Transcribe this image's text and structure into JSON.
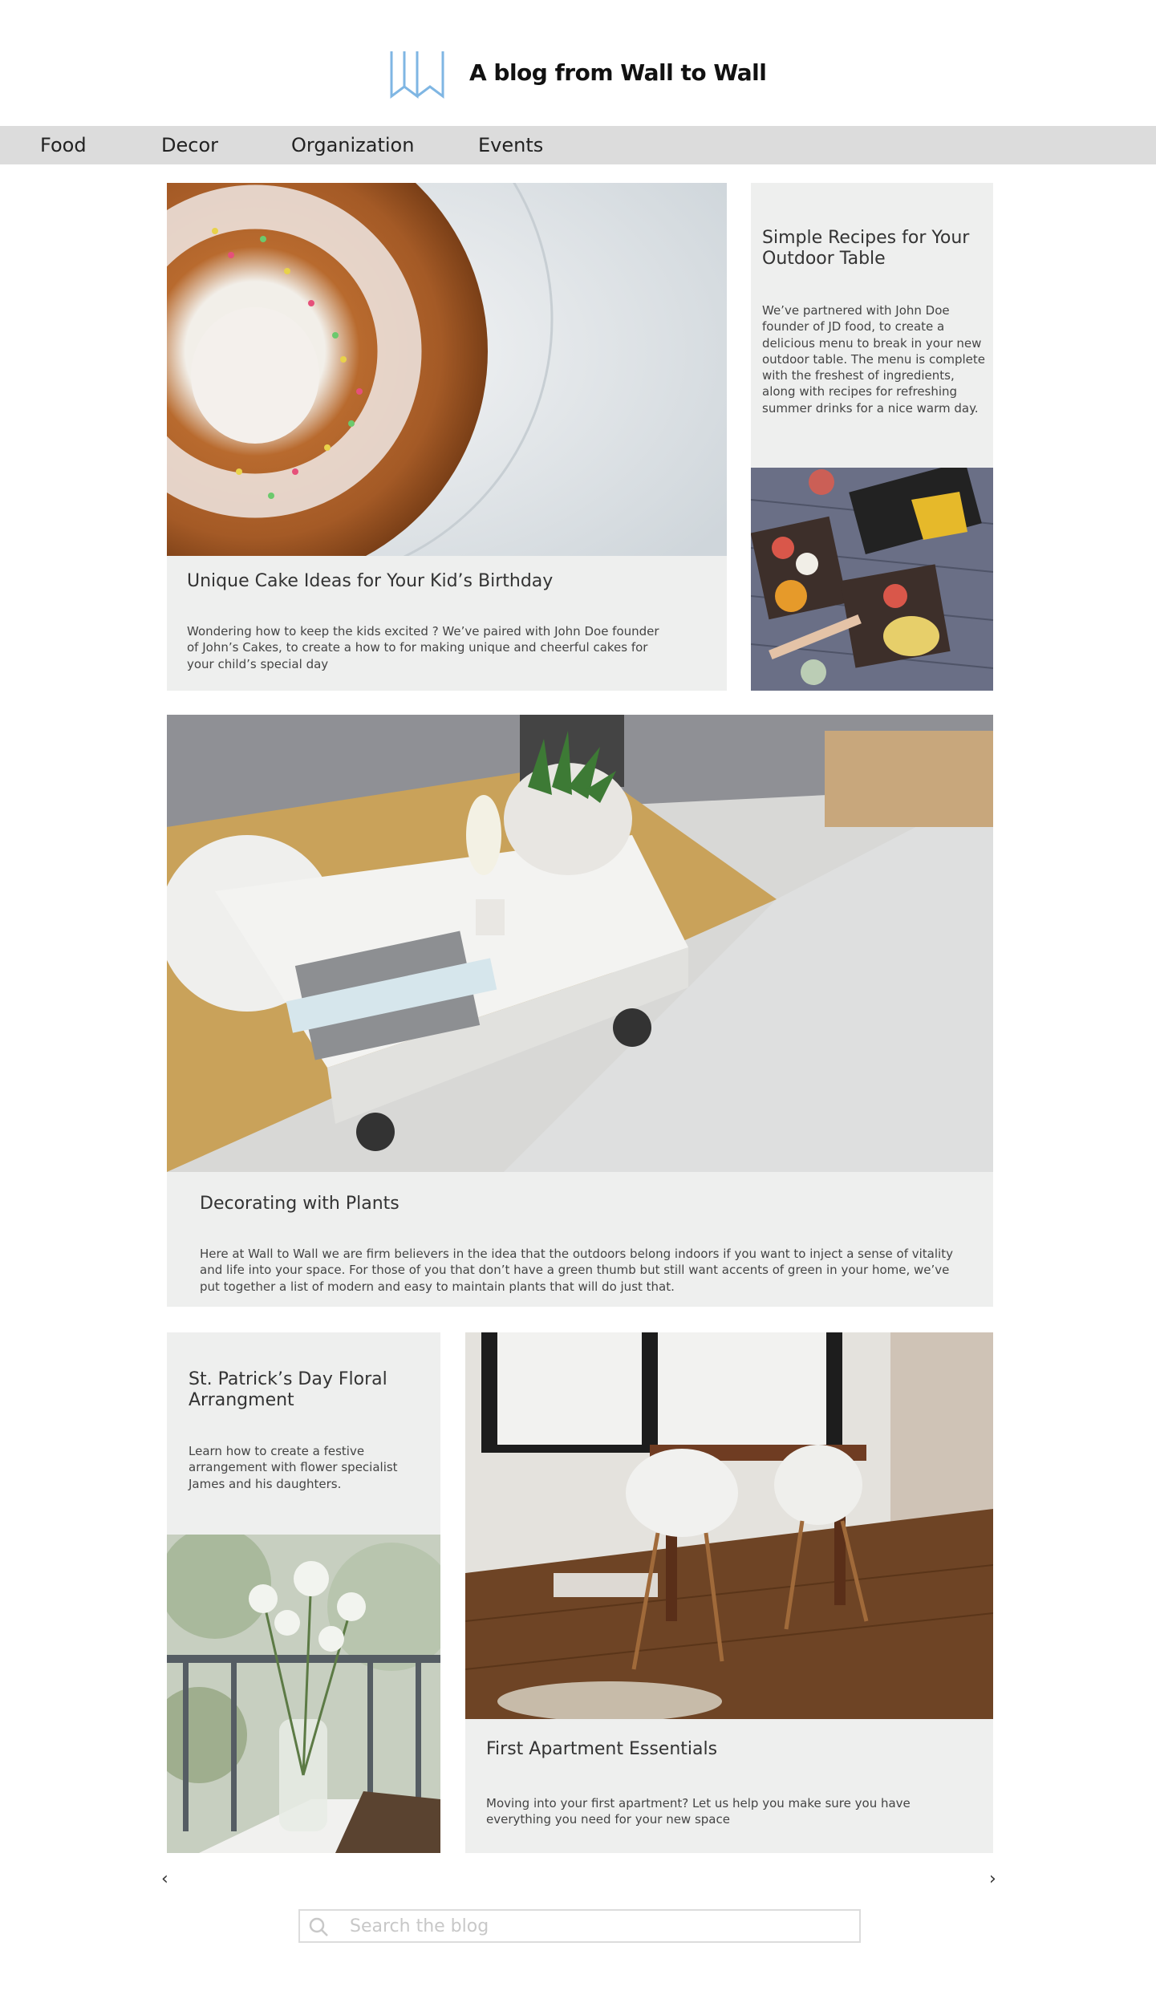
{
  "header": {
    "logo_icon": "wall-logo-icon",
    "site_title": "A blog from Wall to Wall",
    "accent_color": "#7fb6e3"
  },
  "nav": {
    "items": [
      {
        "label": "Food"
      },
      {
        "label": "Decor"
      },
      {
        "label": "Organization"
      },
      {
        "label": "Events"
      }
    ],
    "background": "#dcdcdc"
  },
  "posts": [
    {
      "title": "Unique Cake Ideas for Your Kid’s Birthday",
      "text": "Wondering how to keep the kids excited ? We’ve paired with John Doe founder of John’s Cakes, to create a how to for making unique and cheerful cakes for your child’s special day",
      "image": "bundt-cake-with-sprinkles"
    },
    {
      "title": "Simple Recipes for Your Outdoor Table",
      "text": "We’ve partnered with John Doe founder of JD food, to create a delicious menu to break in your new outdoor table. The menu is complete with the freshest of ingredients, along with recipes for refreshing summer drinks for a nice warm day.",
      "image": "table-with-snack-platters"
    },
    {
      "title": "Decorating with Plants",
      "text": "Here at Wall to Wall we are firm believers in the idea that the outdoors belong indoors if you want to inject a sense of vitality and life into your space. For those of you that don’t have a green thumb but still want accents of green in your home, we’ve put together a list of modern and easy to maintain plants that will do just that.",
      "image": "living-room-coffee-table-plants"
    },
    {
      "title": "St. Patrick’s Day Floral Arrangment",
      "text": "Learn how to create a festive arrangement with flower specialist James and his daughters.",
      "image": "white-flowers-in-glass-vase"
    },
    {
      "title": "First Apartment Essentials",
      "text": "Moving into your first apartment? Let us help you make sure you have everything you need for your new space",
      "image": "dining-table-with-white-chairs"
    }
  ],
  "pagination": {
    "prev": "‹",
    "next": "›"
  },
  "search": {
    "placeholder": "Search the blog",
    "value": "",
    "icon": "search-icon"
  },
  "colors": {
    "card_background": "#eeefee",
    "text": "#333333"
  }
}
